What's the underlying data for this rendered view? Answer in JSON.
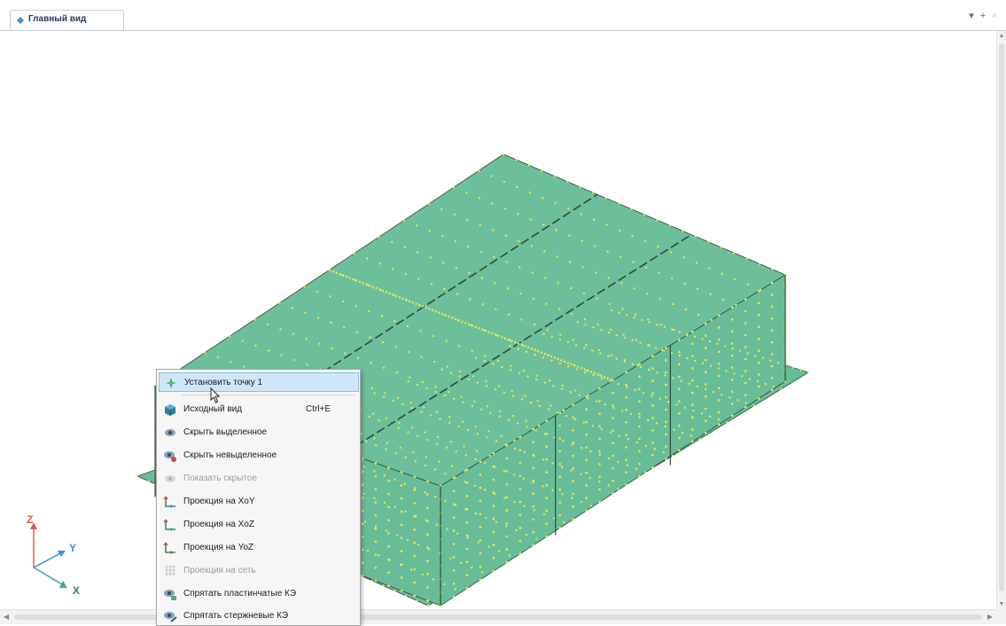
{
  "tab": {
    "title": "Главный вид"
  },
  "toolbar": {
    "pin_glyph": "▾",
    "add_glyph": "+",
    "close_glyph": "×"
  },
  "axes": {
    "z": "Z",
    "y": "Y",
    "x": "X"
  },
  "colors": {
    "slab_top": "#6cbf9a",
    "slab_side": "#68bd98",
    "node": "#e4e85a",
    "edge": "#2e4a3c",
    "accent": "#3b8fd6"
  },
  "context_menu": {
    "items": [
      {
        "label": "Установить точку 1",
        "shortcut": "",
        "icon": "set-point-icon",
        "enabled": true,
        "highlighted": true
      },
      {
        "label": "Исходный вид",
        "shortcut": "Ctrl+E",
        "icon": "cube-icon",
        "enabled": true
      },
      {
        "label": "Скрыть выделенное",
        "shortcut": "",
        "icon": "eye-icon",
        "enabled": true
      },
      {
        "label": "Скрыть невыделенное",
        "shortcut": "",
        "icon": "eye-red-icon",
        "enabled": true
      },
      {
        "label": "Показать скрытое",
        "shortcut": "",
        "icon": "eye-gray-icon",
        "enabled": false
      },
      {
        "label": "Проекция на XoY",
        "shortcut": "",
        "icon": "projection-xoy-icon",
        "enabled": true
      },
      {
        "label": "Проекция на XoZ",
        "shortcut": "",
        "icon": "projection-xoz-icon",
        "enabled": true
      },
      {
        "label": "Проекция на YoZ",
        "shortcut": "",
        "icon": "projection-yoz-icon",
        "enabled": true
      },
      {
        "label": "Проекция на сеть",
        "shortcut": "",
        "icon": "grid-icon",
        "enabled": false
      },
      {
        "label": "Спрятать пластинчатые КЭ",
        "shortcut": "",
        "icon": "plate-hide-icon",
        "enabled": true
      },
      {
        "label": "Спрятать стержневые КЭ",
        "shortcut": "",
        "icon": "bar-hide-icon",
        "enabled": true
      }
    ]
  }
}
